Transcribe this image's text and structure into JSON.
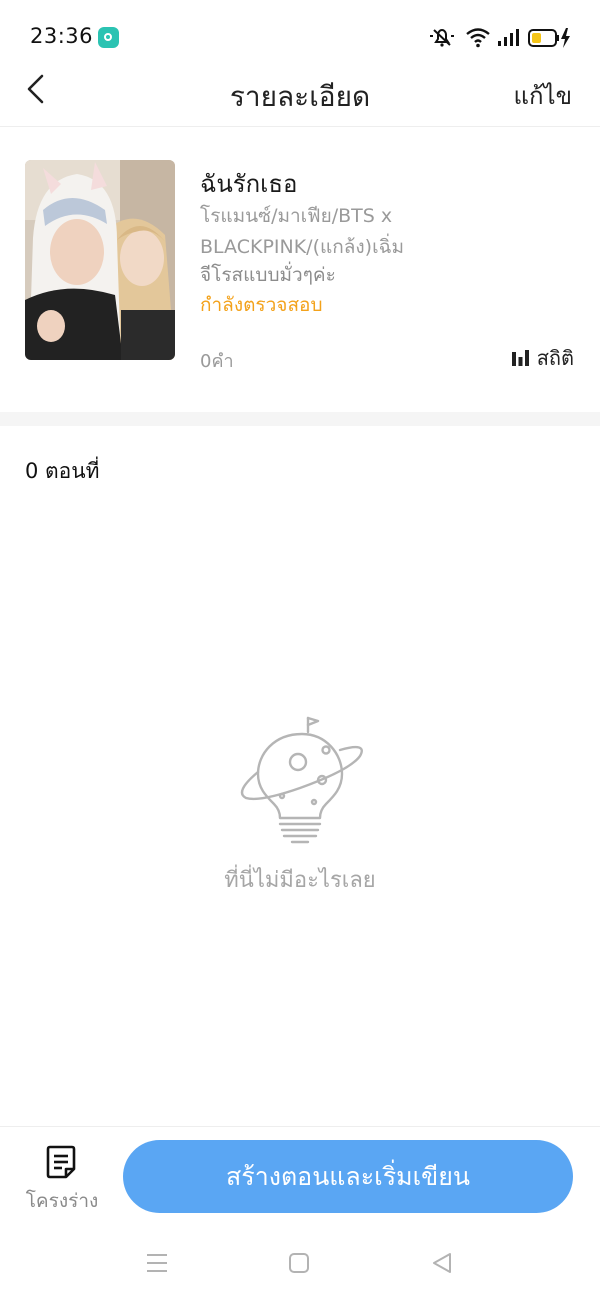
{
  "status_bar": {
    "time": "23:36",
    "icons": [
      "app-notification-icon",
      "mute-icon",
      "wifi-icon",
      "signal-icon",
      "battery-charging-icon"
    ]
  },
  "nav": {
    "back_icon": "chevron-left-icon",
    "title": "รายละเอียด",
    "edit_label": "แก้ไข"
  },
  "book": {
    "title": "ฉันรักเธอ",
    "genre": "โรแมนซ์/มาเฟีย/BTS x BLACKPINK/(แกล้ง)เฉิ่ม",
    "description": "จีโรสแบบมั่วๆค่ะ",
    "status": "กำลังตรวจสอบ",
    "word_count": "0คำ",
    "stats_label": "สถิติ"
  },
  "chapters": {
    "count_label": "0 ตอนที่"
  },
  "empty_state": {
    "icon": "planet-lightbulb-icon",
    "message": "ที่นี่ไม่มีอะไรเลย"
  },
  "bottom_bar": {
    "draft_label": "โครงร่าง",
    "create_label": "สร้างตอนและเริ่มเขียน"
  },
  "colors": {
    "accent_blue": "#5aa6f3",
    "status_orange": "#f3a21b",
    "muted_text": "#9a9a9a"
  }
}
